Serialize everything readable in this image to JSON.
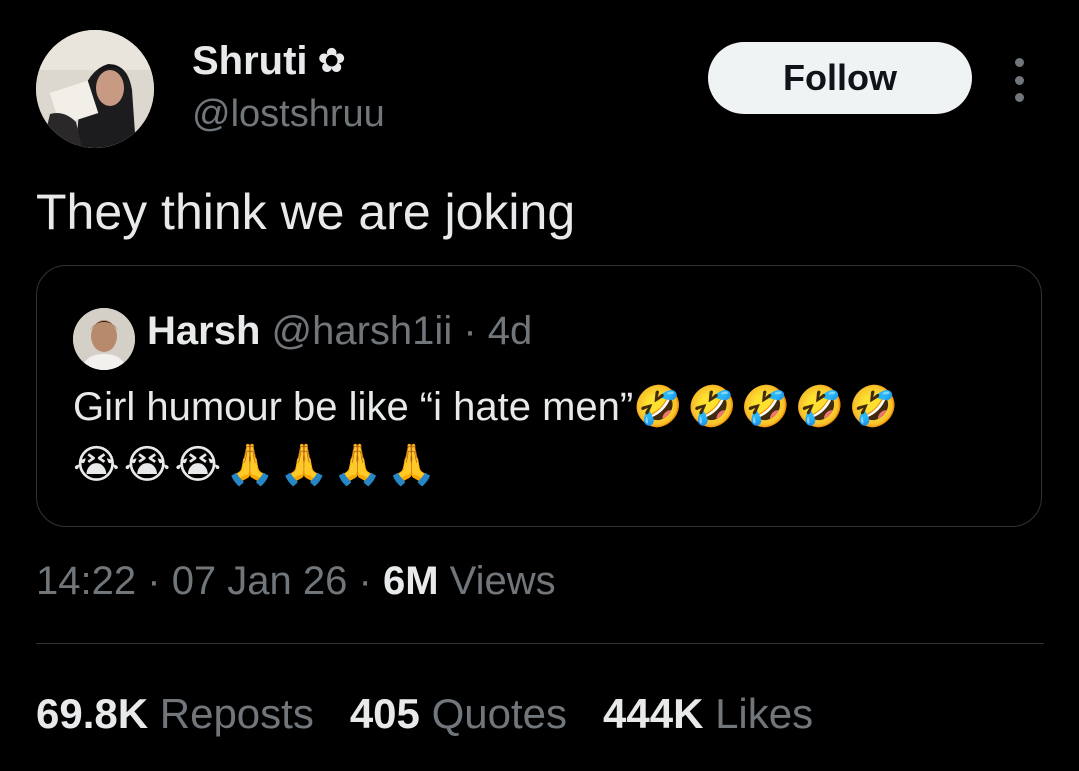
{
  "author": {
    "name": "Shruti",
    "badge_icon": "flower-icon",
    "badge_glyph": "✿",
    "handle": "@lostshruu"
  },
  "follow_label": "Follow",
  "tweet_text": "They think we are joking",
  "quote": {
    "name": "Harsh",
    "handle": "@harsh1ii",
    "separator": "·",
    "age": "4d",
    "text": "Girl humour be like “i hate men”",
    "emoji_line1": "🤣🤣🤣🤣🤣",
    "emoji_line2": "😭😭😭🙏🙏🙏🙏"
  },
  "meta": {
    "time": "14:22",
    "separator": "·",
    "date": "07 Jan 26",
    "views_count": "6M",
    "views_label": "Views"
  },
  "stats": [
    {
      "count": "69.8K",
      "label": "Reposts"
    },
    {
      "count": "405",
      "label": "Quotes"
    },
    {
      "count": "444K",
      "label": "Likes"
    }
  ]
}
